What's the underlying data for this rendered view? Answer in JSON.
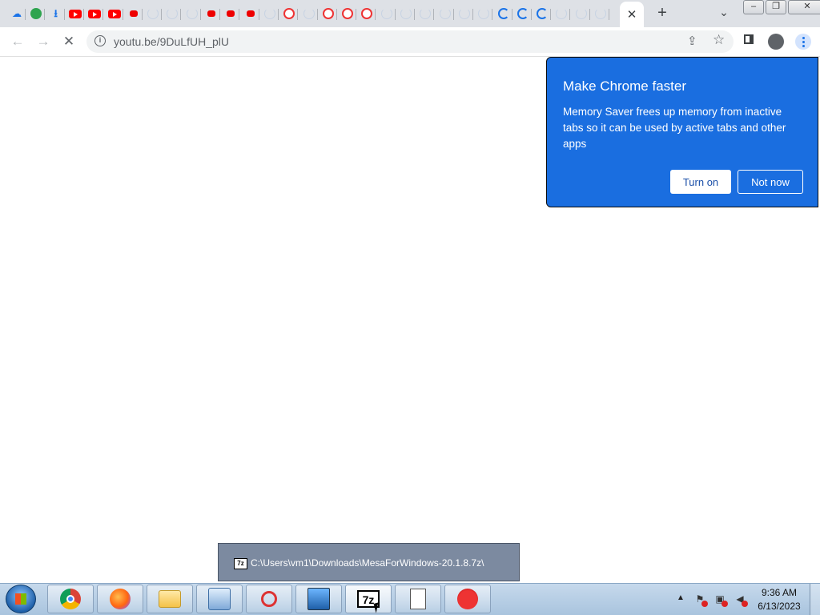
{
  "browser": {
    "tabs": [
      {
        "icon": "cloud-upload-icon",
        "kind": "cloud"
      },
      {
        "icon": "green-app-icon",
        "kind": "green"
      },
      {
        "icon": "download-icon",
        "kind": "dl"
      },
      {
        "icon": "youtube-icon",
        "kind": "yt"
      },
      {
        "icon": "youtube-icon",
        "kind": "yt"
      },
      {
        "icon": "youtube-icon",
        "kind": "yt"
      },
      {
        "icon": "youtube-small-icon",
        "kind": "ytsmall"
      },
      {
        "icon": "blank-page-icon",
        "kind": "blank"
      },
      {
        "icon": "blank-page-icon",
        "kind": "blank"
      },
      {
        "icon": "blank-page-icon",
        "kind": "blank"
      },
      {
        "icon": "youtube-small-icon",
        "kind": "ytsmall"
      },
      {
        "icon": "youtube-small-icon",
        "kind": "ytsmall"
      },
      {
        "icon": "youtube-small-icon",
        "kind": "ytsmall"
      },
      {
        "icon": "blank-page-icon",
        "kind": "blank"
      },
      {
        "icon": "youtube-ring-icon",
        "kind": "ytr"
      },
      {
        "icon": "blank-page-icon",
        "kind": "blank"
      },
      {
        "icon": "youtube-ring-icon",
        "kind": "ytr"
      },
      {
        "icon": "youtube-ring-icon",
        "kind": "ytr"
      },
      {
        "icon": "youtube-ring-icon",
        "kind": "ytr"
      },
      {
        "icon": "blank-page-icon",
        "kind": "blank"
      },
      {
        "icon": "blank-page-icon",
        "kind": "blank"
      },
      {
        "icon": "blank-page-icon",
        "kind": "blank"
      },
      {
        "icon": "blank-page-icon",
        "kind": "blank"
      },
      {
        "icon": "blank-page-icon",
        "kind": "blank"
      },
      {
        "icon": "blank-page-icon",
        "kind": "blank"
      },
      {
        "icon": "loading-spinner-icon",
        "kind": "load"
      },
      {
        "icon": "loading-spinner-icon",
        "kind": "load"
      },
      {
        "icon": "loading-spinner-icon",
        "kind": "load"
      },
      {
        "icon": "blank-page-icon",
        "kind": "blank"
      },
      {
        "icon": "blank-page-icon",
        "kind": "blank"
      },
      {
        "icon": "blank-page-icon",
        "kind": "blank"
      }
    ],
    "active_tab_close": "✕",
    "new_tab": "+",
    "tab_search": "⌄",
    "window_controls": {
      "minimize": "–",
      "restore": "❐",
      "close": "✕"
    },
    "nav": {
      "back": "←",
      "forward": "→",
      "stop": "✕"
    },
    "omnibox": {
      "url": "youtu.be/9DuLfUH_plU"
    }
  },
  "popup": {
    "title": "Make Chrome faster",
    "body": "Memory Saver frees up memory from inactive tabs so it can be used by active tabs and other apps",
    "turn_on": "Turn on",
    "not_now": "Not now",
    "accent": "#1a6ee0"
  },
  "tooltip": {
    "icon_label": "7z",
    "path": "C:\\Users\\vm1\\Downloads\\MesaForWindows-20.1.8.7z\\"
  },
  "taskbar": {
    "buttons": [
      {
        "name": "chrome",
        "icon": "chrome-icon"
      },
      {
        "name": "firefox",
        "icon": "firefox-icon"
      },
      {
        "name": "explorer",
        "icon": "folder-icon"
      },
      {
        "name": "control-panel",
        "icon": "control-panel-icon"
      },
      {
        "name": "snipping-tool",
        "icon": "scissors-icon"
      },
      {
        "name": "remote-desktop",
        "icon": "monitor-icon"
      },
      {
        "name": "7zip",
        "icon": "7zip-icon",
        "label": "7z"
      },
      {
        "name": "notepad",
        "icon": "document-icon"
      },
      {
        "name": "angry-birds",
        "icon": "bird-icon"
      }
    ],
    "clock": {
      "time": "9:36 AM",
      "date": "6/13/2023"
    }
  }
}
